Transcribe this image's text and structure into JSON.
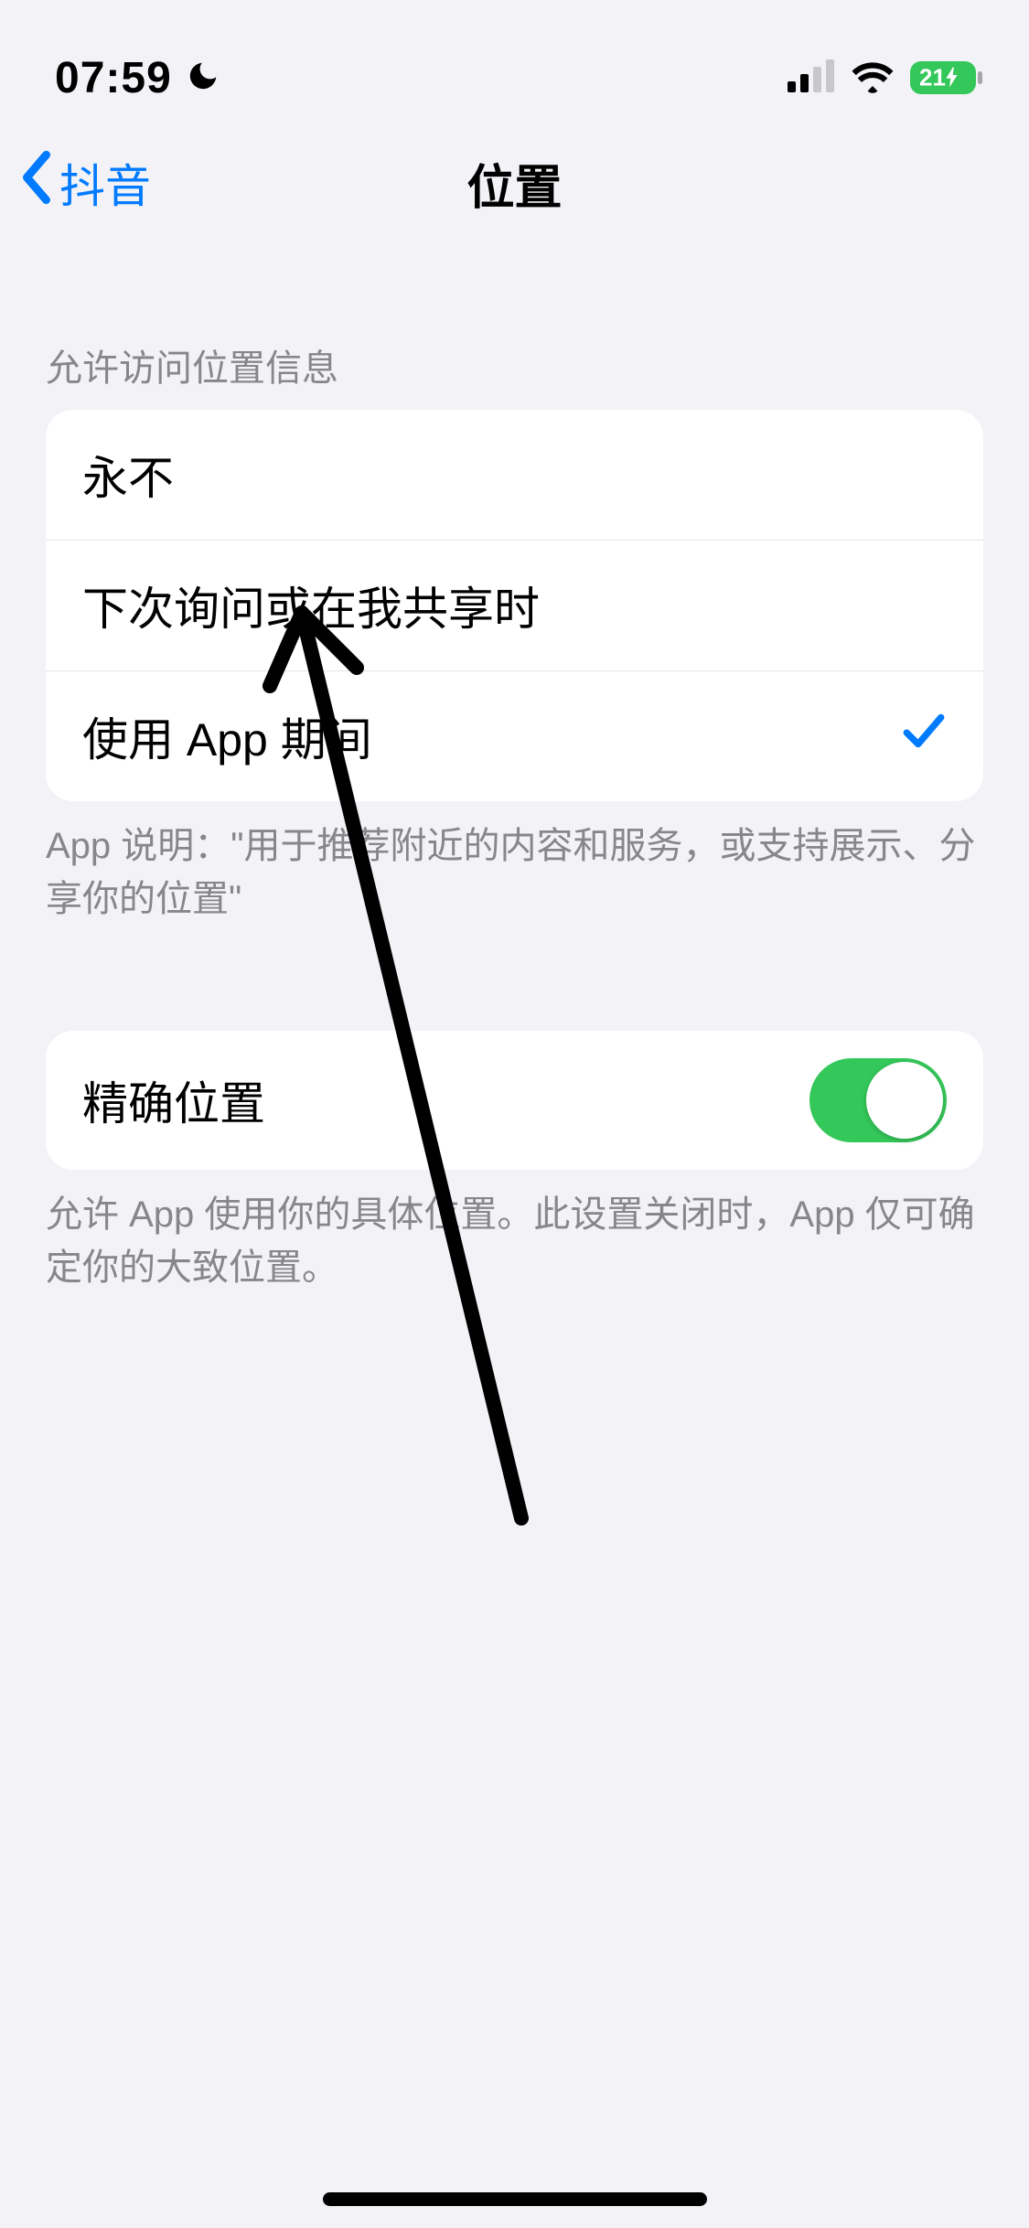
{
  "statusBar": {
    "time": "07:59",
    "batteryPercent": "21"
  },
  "nav": {
    "backLabel": "抖音",
    "title": "位置"
  },
  "accessSection": {
    "header": "允许访问位置信息",
    "options": [
      {
        "label": "永不",
        "selected": false
      },
      {
        "label": "下次询问或在我共享时",
        "selected": false
      },
      {
        "label": "使用 App 期间",
        "selected": true
      }
    ],
    "footer": "App 说明：\"用于推荐附近的内容和服务，或支持展示、分享你的位置\""
  },
  "preciseSection": {
    "label": "精确位置",
    "enabled": true,
    "footer": "允许 App 使用你的具体位置。此设置关闭时，App 仅可确定你的大致位置。"
  },
  "colors": {
    "accent": "#007aff",
    "toggleOn": "#34c759",
    "bodyBg": "#f2f2f7",
    "secondaryText": "#86868b"
  }
}
